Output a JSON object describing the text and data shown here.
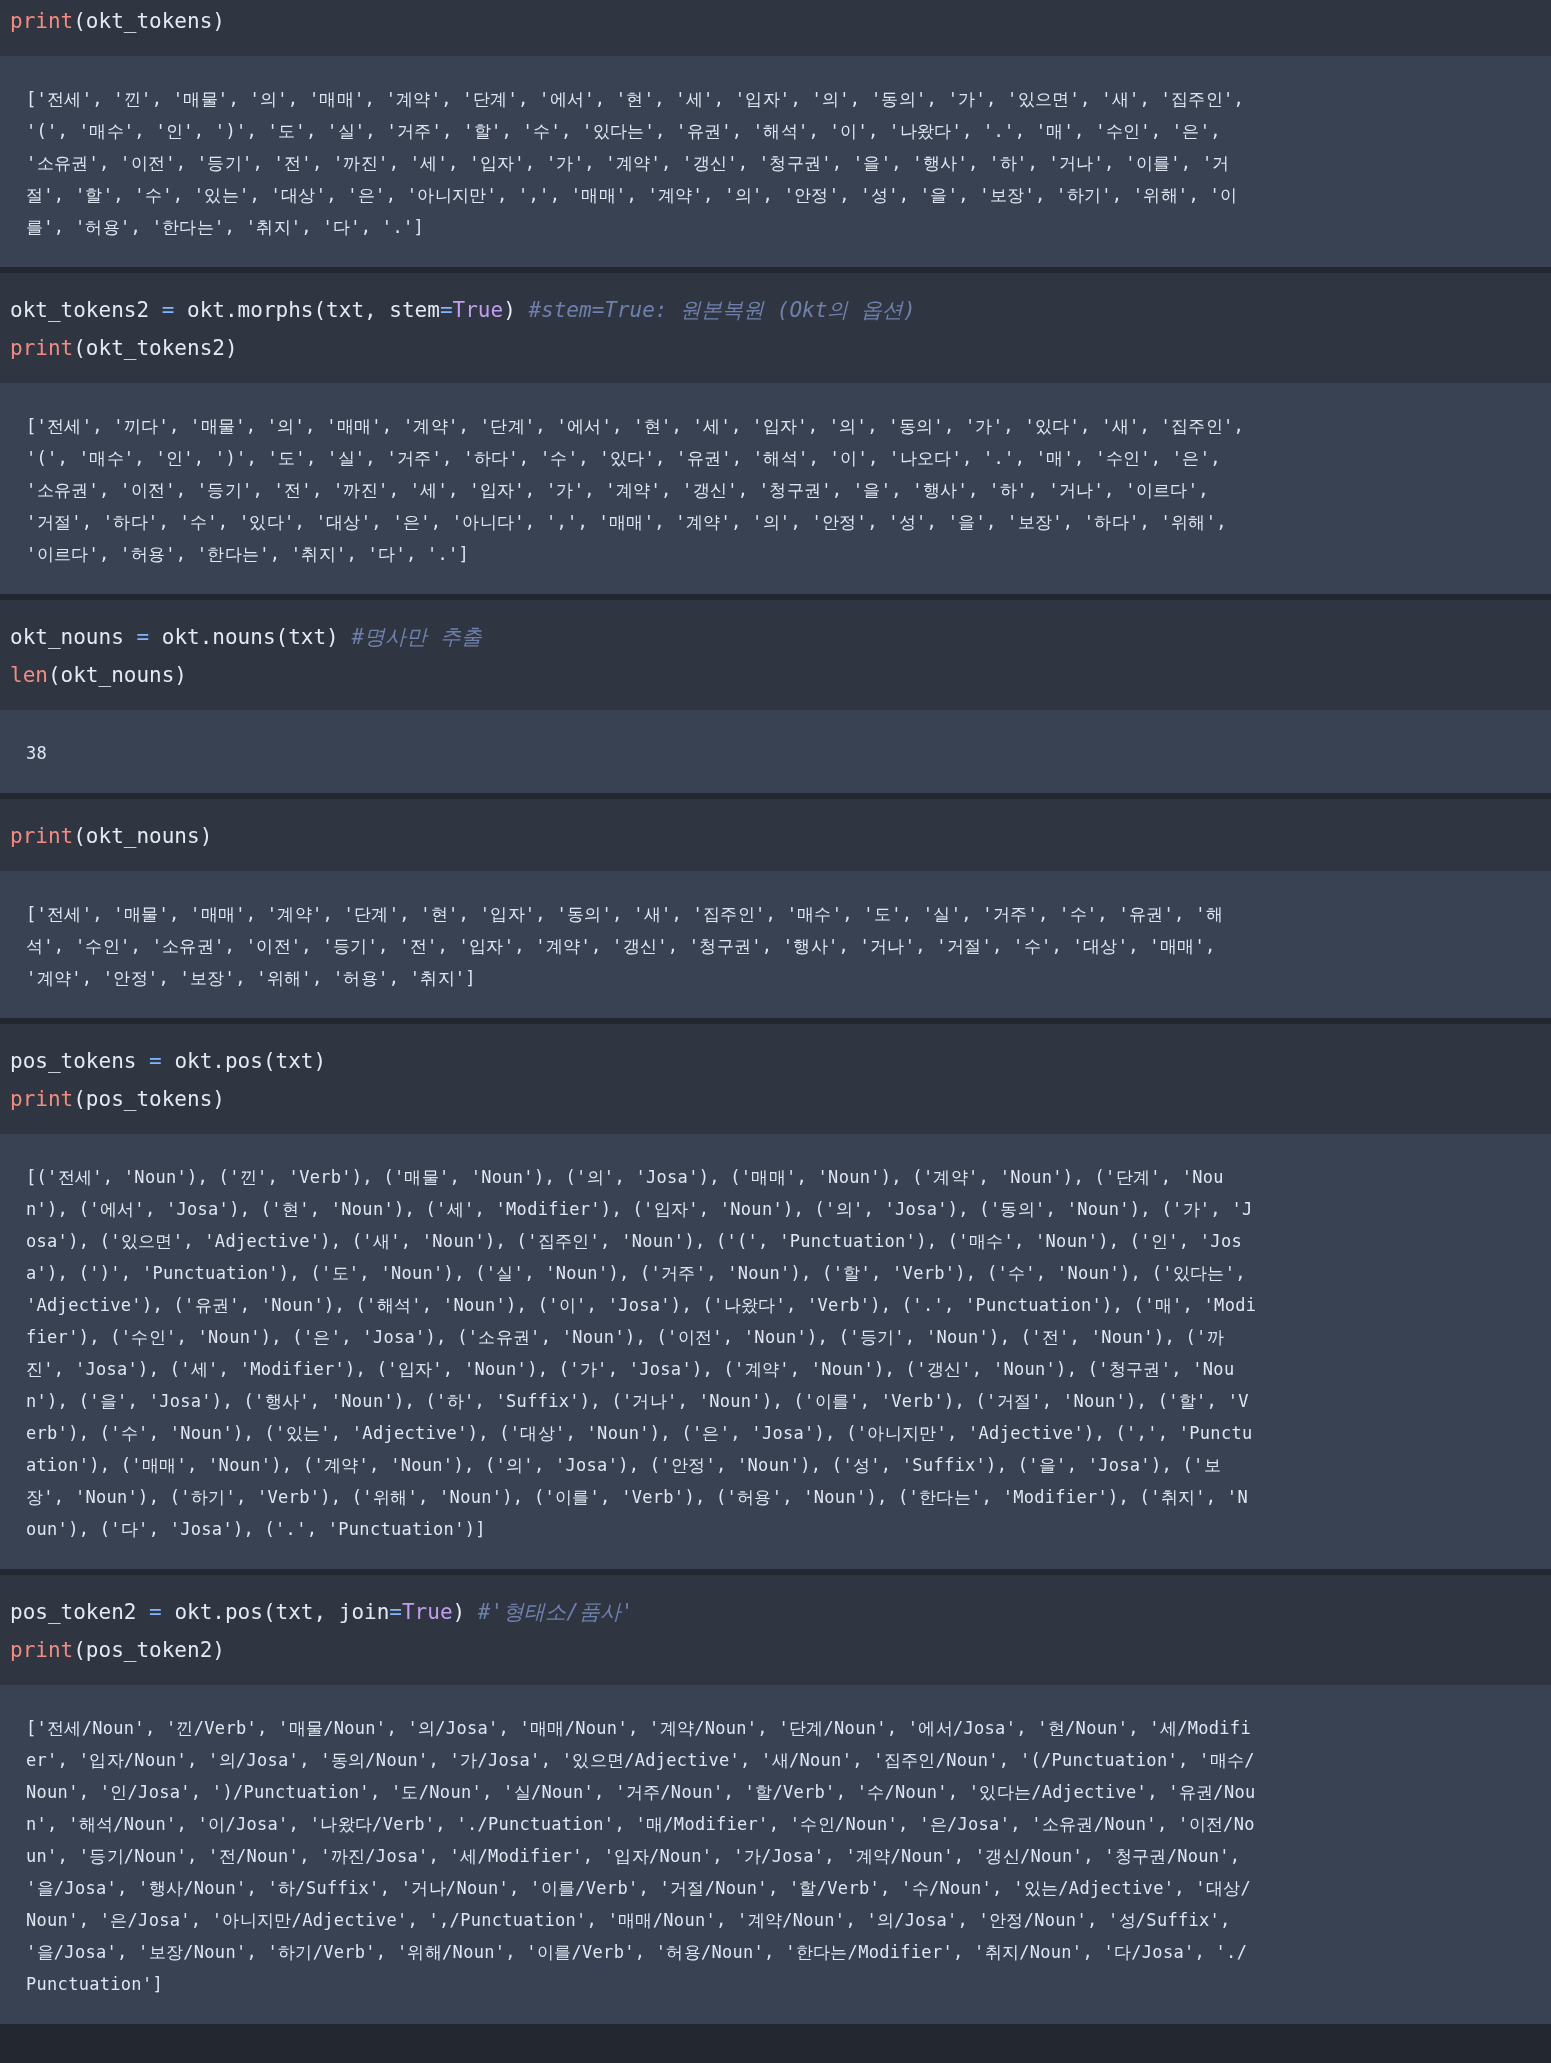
{
  "cells": [
    {
      "code": [
        [
          {
            "kind": "builtin",
            "text": "print"
          },
          {
            "kind": "plain",
            "text": "(okt_tokens)"
          }
        ]
      ],
      "output": [
        "['전세', '낀', '매물', '의', '매매', '계약', '단계', '에서', '현', '세', '입자', '의', '동의', '가', '있으면', '새', '집주인',",
        "'(', '매수', '인', ')', '도', '실', '거주', '할', '수', '있다는', '유권', '해석', '이', '나왔다', '.', '매', '수인', '은',",
        "'소유권', '이전', '등기', '전', '까진', '세', '입자', '가', '계약', '갱신', '청구권', '을', '행사', '하', '거나', '이를', '거",
        "절', '할', '수', '있는', '대상', '은', '아니지만', ',', '매매', '계약', '의', '안정', '성', '을', '보장', '하기', '위해', '이",
        "를', '허용', '한다는', '취지', '다', '.']"
      ]
    },
    {
      "code": [
        [
          {
            "kind": "plain",
            "text": "okt_tokens2 "
          },
          {
            "kind": "operator",
            "text": "="
          },
          {
            "kind": "plain",
            "text": " okt.morphs(txt, stem"
          },
          {
            "kind": "operator",
            "text": "="
          },
          {
            "kind": "constant",
            "text": "True"
          },
          {
            "kind": "plain",
            "text": ") "
          },
          {
            "kind": "comment",
            "text": "#stem=True: 원본복원 (Okt의 옵션)"
          }
        ],
        [
          {
            "kind": "builtin",
            "text": "print"
          },
          {
            "kind": "plain",
            "text": "(okt_tokens2)"
          }
        ]
      ],
      "output": [
        "['전세', '끼다', '매물', '의', '매매', '계약', '단계', '에서', '현', '세', '입자', '의', '동의', '가', '있다', '새', '집주인',",
        "'(', '매수', '인', ')', '도', '실', '거주', '하다', '수', '있다', '유권', '해석', '이', '나오다', '.', '매', '수인', '은',",
        "'소유권', '이전', '등기', '전', '까진', '세', '입자', '가', '계약', '갱신', '청구권', '을', '행사', '하', '거나', '이르다',",
        "'거절', '하다', '수', '있다', '대상', '은', '아니다', ',', '매매', '계약', '의', '안정', '성', '을', '보장', '하다', '위해',",
        "'이르다', '허용', '한다는', '취지', '다', '.']"
      ]
    },
    {
      "code": [
        [
          {
            "kind": "plain",
            "text": "okt_nouns "
          },
          {
            "kind": "operator",
            "text": "="
          },
          {
            "kind": "plain",
            "text": " okt.nouns(txt) "
          },
          {
            "kind": "comment",
            "text": "#명사만 추출"
          }
        ],
        [
          {
            "kind": "builtin",
            "text": "len"
          },
          {
            "kind": "plain",
            "text": "(okt_nouns)"
          }
        ]
      ],
      "output": [
        "38"
      ]
    },
    {
      "code": [
        [
          {
            "kind": "builtin",
            "text": "print"
          },
          {
            "kind": "plain",
            "text": "(okt_nouns)"
          }
        ]
      ],
      "output": [
        "['전세', '매물', '매매', '계약', '단계', '현', '입자', '동의', '새', '집주인', '매수', '도', '실', '거주', '수', '유권', '해",
        "석', '수인', '소유권', '이전', '등기', '전', '입자', '계약', '갱신', '청구권', '행사', '거나', '거절', '수', '대상', '매매',",
        "'계약', '안정', '보장', '위해', '허용', '취지']"
      ]
    },
    {
      "code": [
        [
          {
            "kind": "plain",
            "text": "pos_tokens "
          },
          {
            "kind": "operator",
            "text": "="
          },
          {
            "kind": "plain",
            "text": " okt.pos(txt)"
          }
        ],
        [
          {
            "kind": "builtin",
            "text": "print"
          },
          {
            "kind": "plain",
            "text": "(pos_tokens)"
          }
        ]
      ],
      "output": [
        "[('전세', 'Noun'), ('낀', 'Verb'), ('매물', 'Noun'), ('의', 'Josa'), ('매매', 'Noun'), ('계약', 'Noun'), ('단계', 'Nou",
        "n'), ('에서', 'Josa'), ('현', 'Noun'), ('세', 'Modifier'), ('입자', 'Noun'), ('의', 'Josa'), ('동의', 'Noun'), ('가', 'J",
        "osa'), ('있으면', 'Adjective'), ('새', 'Noun'), ('집주인', 'Noun'), ('(', 'Punctuation'), ('매수', 'Noun'), ('인', 'Jos",
        "a'), (')', 'Punctuation'), ('도', 'Noun'), ('실', 'Noun'), ('거주', 'Noun'), ('할', 'Verb'), ('수', 'Noun'), ('있다는',",
        "'Adjective'), ('유권', 'Noun'), ('해석', 'Noun'), ('이', 'Josa'), ('나왔다', 'Verb'), ('.', 'Punctuation'), ('매', 'Modi",
        "fier'), ('수인', 'Noun'), ('은', 'Josa'), ('소유권', 'Noun'), ('이전', 'Noun'), ('등기', 'Noun'), ('전', 'Noun'), ('까",
        "진', 'Josa'), ('세', 'Modifier'), ('입자', 'Noun'), ('가', 'Josa'), ('계약', 'Noun'), ('갱신', 'Noun'), ('청구권', 'Nou",
        "n'), ('을', 'Josa'), ('행사', 'Noun'), ('하', 'Suffix'), ('거나', 'Noun'), ('이를', 'Verb'), ('거절', 'Noun'), ('할', 'V",
        "erb'), ('수', 'Noun'), ('있는', 'Adjective'), ('대상', 'Noun'), ('은', 'Josa'), ('아니지만', 'Adjective'), (',', 'Punctu",
        "ation'), ('매매', 'Noun'), ('계약', 'Noun'), ('의', 'Josa'), ('안정', 'Noun'), ('성', 'Suffix'), ('을', 'Josa'), ('보",
        "장', 'Noun'), ('하기', 'Verb'), ('위해', 'Noun'), ('이를', 'Verb'), ('허용', 'Noun'), ('한다는', 'Modifier'), ('취지', 'N",
        "oun'), ('다', 'Josa'), ('.', 'Punctuation')]"
      ]
    },
    {
      "code": [
        [
          {
            "kind": "plain",
            "text": "pos_token2 "
          },
          {
            "kind": "operator",
            "text": "="
          },
          {
            "kind": "plain",
            "text": " okt.pos(txt, join"
          },
          {
            "kind": "operator",
            "text": "="
          },
          {
            "kind": "constant",
            "text": "True"
          },
          {
            "kind": "plain",
            "text": ") "
          },
          {
            "kind": "comment",
            "text": "#'형태소/품사'"
          }
        ],
        [
          {
            "kind": "builtin",
            "text": "print"
          },
          {
            "kind": "plain",
            "text": "(pos_token2)"
          }
        ]
      ],
      "output": [
        "['전세/Noun', '낀/Verb', '매물/Noun', '의/Josa', '매매/Noun', '계약/Noun', '단계/Noun', '에서/Josa', '현/Noun', '세/Modifi",
        "er', '입자/Noun', '의/Josa', '동의/Noun', '가/Josa', '있으면/Adjective', '새/Noun', '집주인/Noun', '(/Punctuation', '매수/",
        "Noun', '인/Josa', ')/Punctuation', '도/Noun', '실/Noun', '거주/Noun', '할/Verb', '수/Noun', '있다는/Adjective', '유권/Nou",
        "n', '해석/Noun', '이/Josa', '나왔다/Verb', './Punctuation', '매/Modifier', '수인/Noun', '은/Josa', '소유권/Noun', '이전/No",
        "un', '등기/Noun', '전/Noun', '까진/Josa', '세/Modifier', '입자/Noun', '가/Josa', '계약/Noun', '갱신/Noun', '청구권/Noun',",
        "'을/Josa', '행사/Noun', '하/Suffix', '거나/Noun', '이를/Verb', '거절/Noun', '할/Verb', '수/Noun', '있는/Adjective', '대상/",
        "Noun', '은/Josa', '아니지만/Adjective', ',/Punctuation', '매매/Noun', '계약/Noun', '의/Josa', '안정/Noun', '성/Suffix',",
        "'을/Josa', '보장/Noun', '하기/Verb', '위해/Noun', '이를/Verb', '허용/Noun', '한다는/Modifier', '취지/Noun', '다/Josa', './",
        "Punctuation']"
      ]
    }
  ]
}
